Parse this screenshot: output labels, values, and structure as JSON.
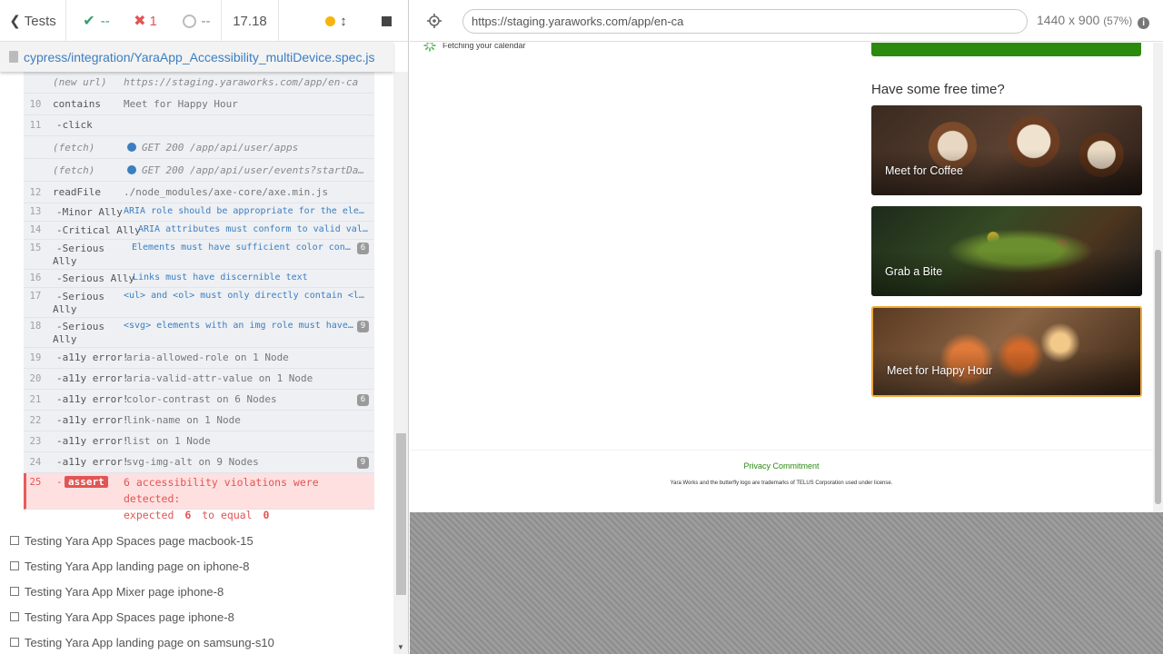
{
  "stats": {
    "back_label": "Tests",
    "passed": "--",
    "failed": "1",
    "pending": "--",
    "duration": "17.18"
  },
  "spec_path": "cypress/integration/YaraApp_Accessibility_multiDevice.spec.js",
  "commands": [
    {
      "num": "",
      "name": "(new url)",
      "msg": "https://staging.yaraworks.com/app/en-ca",
      "style": "ital"
    },
    {
      "num": "10",
      "name": "contains",
      "msg": "Meet for Happy Hour",
      "style": ""
    },
    {
      "num": "11",
      "name": "-click",
      "msg": "",
      "style": ""
    },
    {
      "num": "",
      "name": "(fetch)",
      "msg": "GET 200 /app/api/user/apps",
      "style": "fetch"
    },
    {
      "num": "",
      "name": "(fetch)",
      "msg": "GET 200 /app/api/user/events?startDa…",
      "style": "fetch"
    },
    {
      "num": "12",
      "name": "readFile",
      "msg": "./node_modules/axe-core/axe.min.js",
      "style": ""
    },
    {
      "num": "13",
      "name": "-Minor Ally",
      "msg": "ARIA role should be appropriate for the element",
      "style": "blue"
    },
    {
      "num": "14",
      "name": "-Critical Ally",
      "msg": "ARIA attributes must conform to valid values",
      "style": "blue"
    },
    {
      "num": "15",
      "name": "-Serious",
      "name2": "Ally",
      "msg": "Elements must have sufficient color contra…",
      "style": "blue",
      "badge": "6"
    },
    {
      "num": "16",
      "name": "-Serious Ally",
      "msg": "Links must have discernible text",
      "style": "blue"
    },
    {
      "num": "17",
      "name": "-Serious",
      "name2": "Ally",
      "msg": "<ul> and <ol> must only directly contain <li>, …",
      "style": "blue"
    },
    {
      "num": "18",
      "name": "-Serious",
      "name2": "Ally",
      "msg": "<svg> elements with an img role must have an…",
      "style": "blue",
      "badge": "9"
    },
    {
      "num": "19",
      "name": "-a11y error!",
      "msg": "aria-allowed-role on 1 Node",
      "style": ""
    },
    {
      "num": "20",
      "name": "-a11y error!",
      "msg": "aria-valid-attr-value on 1 Node",
      "style": ""
    },
    {
      "num": "21",
      "name": "-a11y error!",
      "msg": "color-contrast on 6 Nodes",
      "style": "",
      "badge": "6"
    },
    {
      "num": "22",
      "name": "-a11y error!",
      "msg": "link-name on 1 Node",
      "style": ""
    },
    {
      "num": "23",
      "name": "-a11y error!",
      "msg": "list on 1 Node",
      "style": ""
    },
    {
      "num": "24",
      "name": "-a11y error!",
      "msg": "svg-img-alt on 9 Nodes",
      "style": "",
      "badge": "9"
    }
  ],
  "failed_command": {
    "num": "25",
    "dash": "-",
    "tag": "assert",
    "line1": "6 accessibility violations were detected:",
    "line2_a": "expected",
    "line2_b": "6",
    "line2_c": "to equal",
    "line2_d": "0"
  },
  "tests": [
    "Testing Yara App Spaces page macbook-15",
    "Testing Yara App landing page on iphone-8",
    "Testing Yara App Mixer page iphone-8",
    "Testing Yara App Spaces page iphone-8",
    "Testing Yara App landing page on samsung-s10"
  ],
  "aut": {
    "url": "https://staging.yaraworks.com/app/en-ca",
    "viewport": "1440 x 900",
    "zoom": "(57%)",
    "fetching": "Fetching your calendar",
    "free_time_title": "Have some free time?",
    "cards": [
      "Meet for Coffee",
      "Grab a Bite",
      "Meet for Happy Hour"
    ],
    "privacy": "Privacy Commitment",
    "trademark": "Yara Works and the butterfly logo are trademarks of TELUS Corporation used under license."
  },
  "colors": {
    "passed": "#33a06f",
    "failed": "#e05555",
    "green_bar": "#2c8a0f",
    "card_highlight": "#f0a93a"
  }
}
